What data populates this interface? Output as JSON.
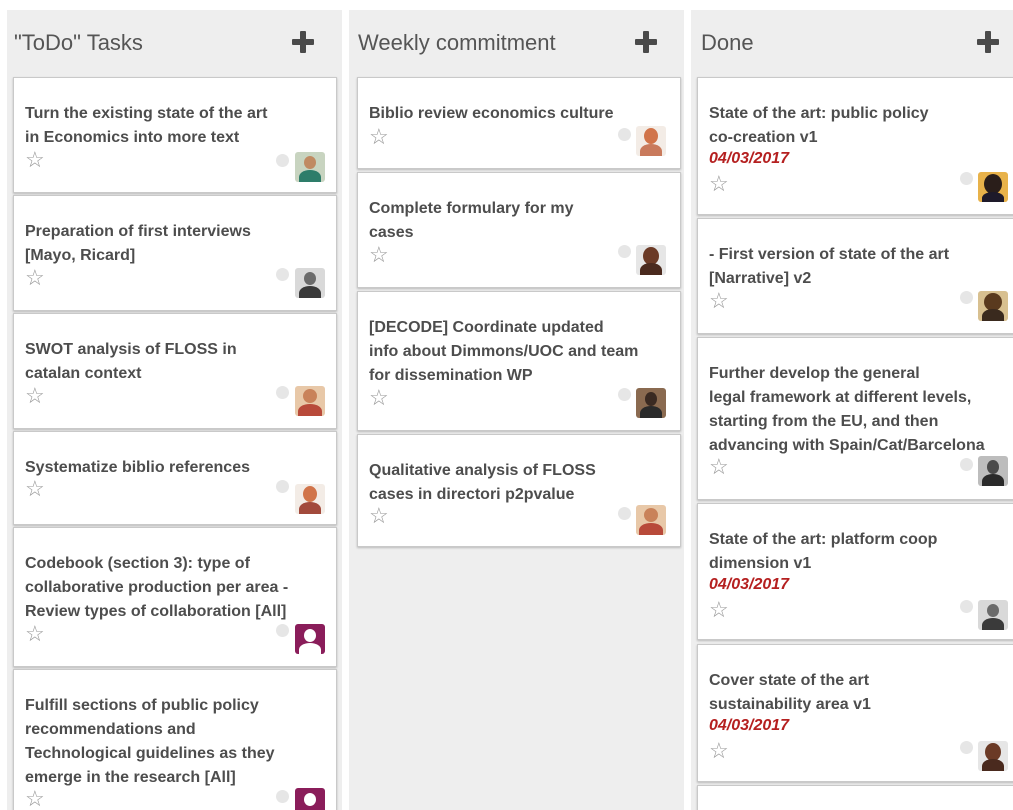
{
  "board": {
    "columns": [
      {
        "title": "\"ToDo\" Tasks",
        "add_icon": "plus-icon",
        "cards": [
          {
            "title": "Turn the existing state of the art\nin Economics into more text",
            "star_icon": "star-outline-icon"
          },
          {
            "title": "Preparation of first interviews\n[Mayo, Ricard]",
            "star_icon": "star-outline-icon"
          },
          {
            "title": "SWOT analysis of FLOSS in\ncatalan context",
            "star_icon": "star-outline-icon"
          },
          {
            "title": "Systematize biblio references",
            "star_icon": "star-outline-icon"
          },
          {
            "title": "Codebook (section 3): type of\ncollaborative production per area -\nReview types of collaboration [All]",
            "star_icon": "star-outline-icon"
          },
          {
            "title": "Fulfill sections of public policy\nrecommendations and\nTechnological guidelines as they\nemerge in the research [All]",
            "star_icon": "star-outline-icon"
          }
        ]
      },
      {
        "title": "Weekly commitment",
        "add_icon": "plus-icon",
        "cards": [
          {
            "title": "Biblio review economics culture",
            "star_icon": "star-outline-icon"
          },
          {
            "title": "Complete formulary for my\ncases",
            "star_icon": "star-outline-icon"
          },
          {
            "title": "[DECODE] Coordinate updated\ninfo about Dimmons/UOC and team\nfor dissemination WP",
            "star_icon": "star-outline-icon"
          },
          {
            "title": "Qualitative analysis of FLOSS\ncases in directori p2pvalue",
            "star_icon": "star-outline-icon"
          }
        ]
      },
      {
        "title": "Done",
        "add_icon": "plus-icon",
        "cards": [
          {
            "title": "State of the art: public policy\nco-creation v1",
            "date": "04/03/2017",
            "star_icon": "star-outline-icon"
          },
          {
            "title": "- First version of state of the art\n[Narrative] v2",
            "star_icon": "star-outline-icon"
          },
          {
            "title": "Further develop the general\nlegal framework at different levels,\nstarting from the EU, and then\nadvancing with Spain/Cat/Barcelona",
            "star_icon": "star-outline-icon"
          },
          {
            "title": "State of the art: platform coop\ndimension v1",
            "date": "04/03/2017",
            "star_icon": "star-outline-icon"
          },
          {
            "title": "Cover state of the art\nsustainability area v1",
            "date": "04/03/2017",
            "star_icon": "star-outline-icon"
          }
        ]
      }
    ]
  },
  "colors": {
    "column_background": "#eeeeee",
    "card_background": "#ffffff",
    "card_title": "#4d4d4d",
    "date": "#b52020",
    "header_text": "#555555"
  }
}
